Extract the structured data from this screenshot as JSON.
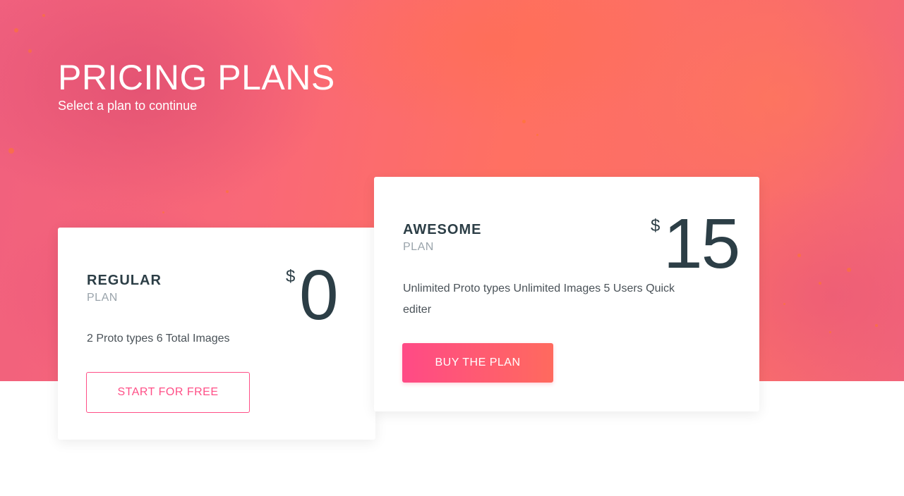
{
  "hero": {
    "title": "PRICING PLANS",
    "subtitle": "Select a plan to continue"
  },
  "plans": [
    {
      "name": "REGULAR",
      "label": "PLAN",
      "currency": "$",
      "price": "0",
      "features": "2 Proto types 6 Total Images",
      "button_label": "START FOR FREE",
      "button_style": "outline"
    },
    {
      "name": "AWESOME",
      "label": "PLAN",
      "currency": "$",
      "price": "15",
      "features": "Unlimited Proto types Unlimited Images 5 Users Quick editer",
      "button_label": "BUY THE PLAN",
      "button_style": "solid"
    }
  ],
  "colors": {
    "accent": "#ff4f87",
    "accent_gradient_end": "#ff6a5e",
    "text_dark": "#2c3e46",
    "text_muted": "#9aa4ab"
  }
}
